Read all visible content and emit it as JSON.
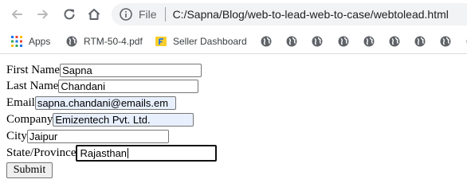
{
  "browser": {
    "omnibox": {
      "scheme_label": "File",
      "url": "C:/Sapna/Blog/web-to-lead-web-to-case/webtolead.html"
    },
    "bookmarks": [
      {
        "label": "Apps",
        "icon": "apps-grid-icon"
      },
      {
        "label": "RTM-50-4.pdf",
        "icon": "globe-icon"
      },
      {
        "label": "Seller Dashboard",
        "icon": "flipkart-icon"
      }
    ],
    "extra_bookmark_icon_count": 9
  },
  "form": {
    "fields": [
      {
        "label": "First Name",
        "value": "Sapna",
        "autofilled": false
      },
      {
        "label": "Last Name",
        "value": "Chandani",
        "autofilled": false
      },
      {
        "label": "Email",
        "value": "sapna.chandani@emails.em",
        "autofilled": true
      },
      {
        "label": "Company",
        "value": "Emizentech Pvt. Ltd.",
        "autofilled": true
      },
      {
        "label": "City",
        "value": "Jaipur",
        "autofilled": false
      },
      {
        "label": "State/Province",
        "value": "Rajasthan",
        "autofilled": false,
        "focused": true
      }
    ],
    "submit_label": "Submit"
  },
  "colors": {
    "autofill_bg": "#e8f0fe",
    "omnibox_bg": "#f1f3f4"
  }
}
